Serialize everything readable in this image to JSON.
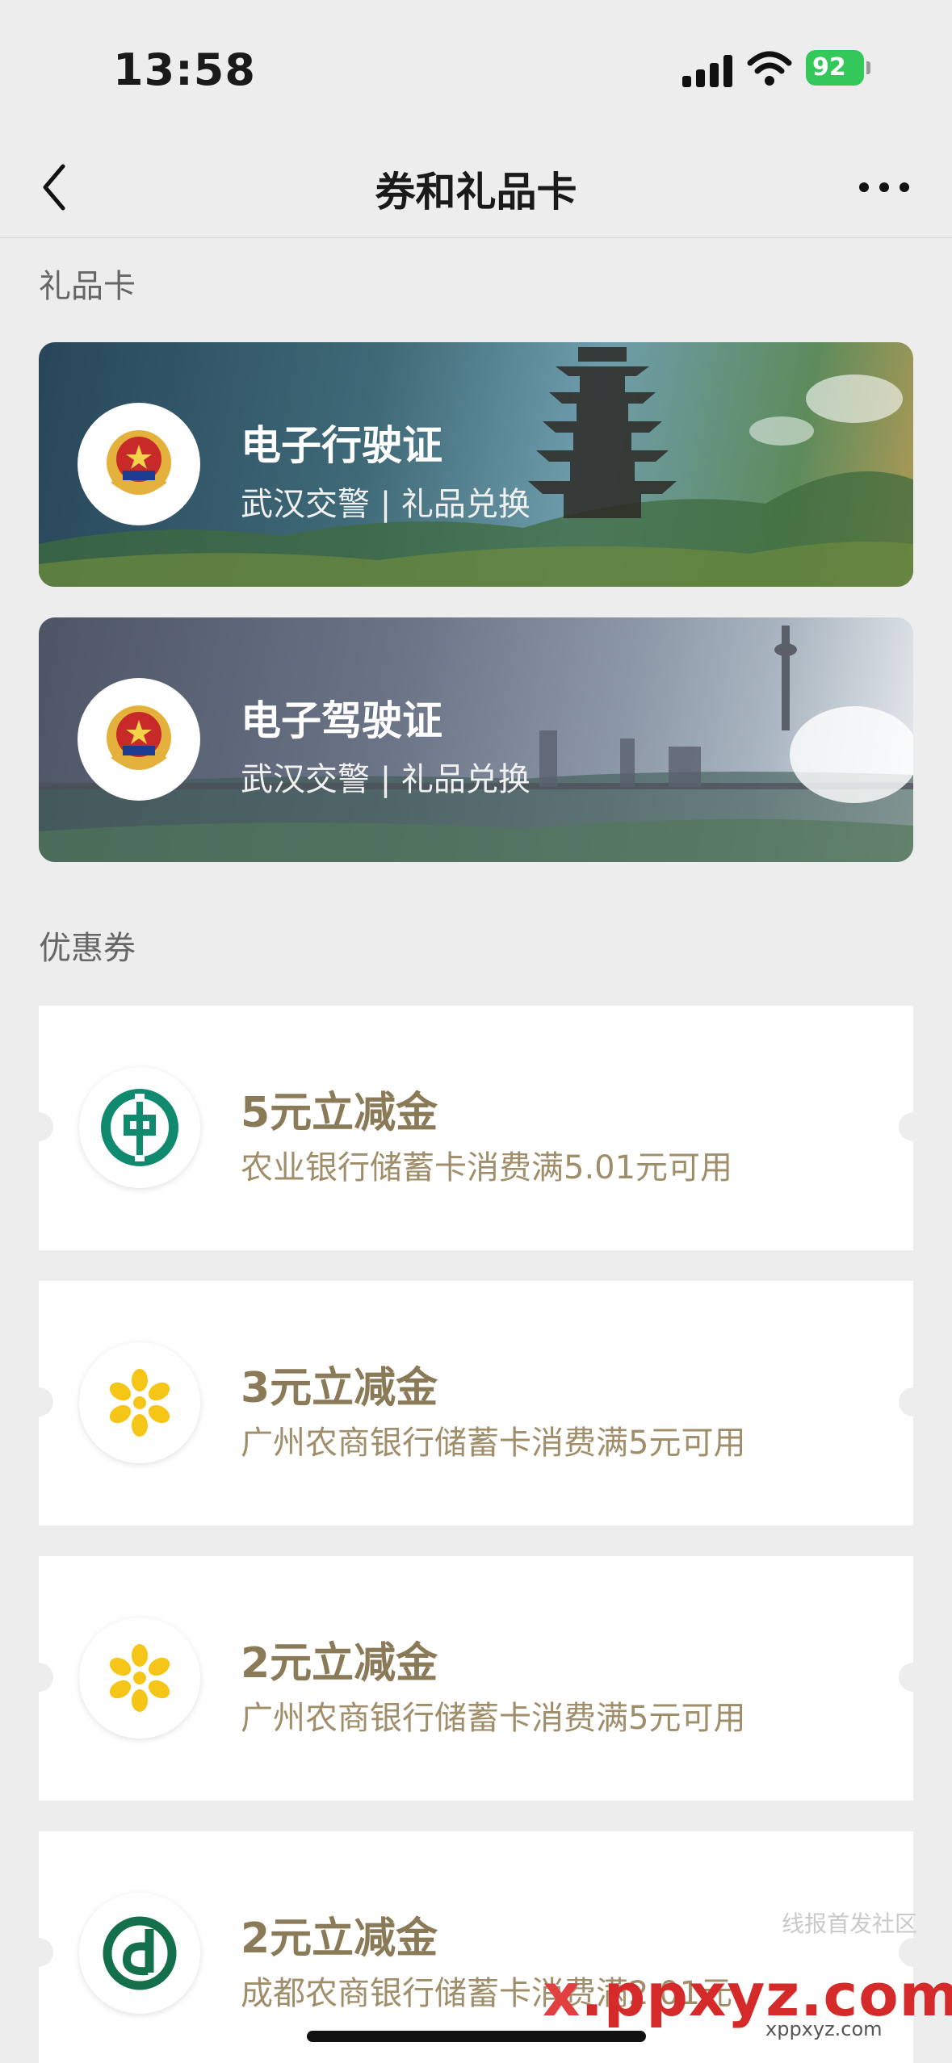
{
  "status_bar": {
    "time": "13:58",
    "battery": "92"
  },
  "nav": {
    "title": "券和礼品卡"
  },
  "sections": {
    "gift_cards": "礼品卡",
    "coupons": "优惠券"
  },
  "gift_cards": [
    {
      "title": "电子行驶证",
      "subtitle": "武汉交警 | 礼品兑换"
    },
    {
      "title": "电子驾驶证",
      "subtitle": "武汉交警 | 礼品兑换"
    }
  ],
  "coupons": [
    {
      "title": "5元立减金",
      "desc": "农业银行储蓄卡消费满5.01元可用",
      "logo": "abc-bank-icon"
    },
    {
      "title": "3元立减金",
      "desc": "广州农商银行储蓄卡消费满5元可用",
      "logo": "grcb-bank-icon"
    },
    {
      "title": "2元立减金",
      "desc": "广州农商银行储蓄卡消费满5元可用",
      "logo": "grcb-bank-icon"
    },
    {
      "title": "2元立减金",
      "desc": "成都农商银行储蓄卡消费满2.01元",
      "logo": "cdrcb-bank-icon"
    }
  ],
  "watermark": {
    "top": "线报首发社区",
    "main_x": "x",
    "main_rest": ".ppxyz.com",
    "sub": "xppxyz.com"
  },
  "colors": {
    "coupon_text": "#8b7a58",
    "background": "#ededed"
  }
}
